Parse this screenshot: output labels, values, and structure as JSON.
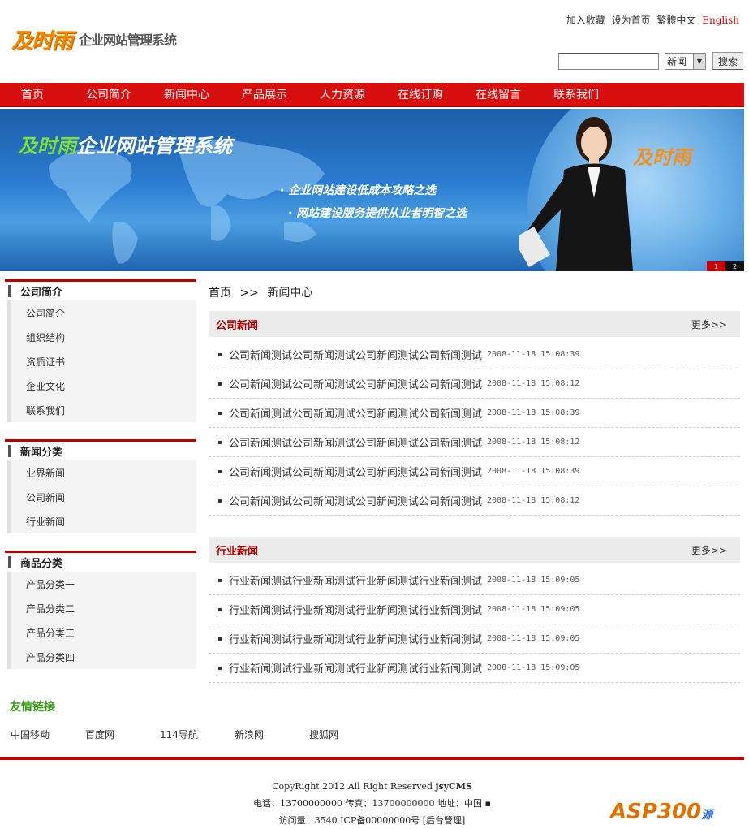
{
  "header": {
    "logo_big": "及时雨",
    "logo_small": "企业网站管理系统",
    "links": [
      "加入收藏",
      "设为首页",
      "繁體中文",
      "English"
    ],
    "search": {
      "placeholder": "",
      "select_value": "新闻",
      "button": "搜索"
    }
  },
  "nav": [
    "首页",
    "公司简介",
    "新闻中心",
    "产品展示",
    "人力资源",
    "在线订购",
    "在线留言",
    "联系我们"
  ],
  "banner": {
    "title_green": "及时雨",
    "title_white": "企业网站管理系统",
    "slogan1": "· 企业网站建设低成本攻略之选",
    "slogan2": "· 网站建设服务提供从业者明智之选",
    "brand": "及时雨",
    "nums": [
      "1",
      "2"
    ]
  },
  "sidebar": [
    {
      "title": "公司简介",
      "items": [
        "公司简介",
        "组织结构",
        "资质证书",
        "企业文化",
        "联系我们"
      ]
    },
    {
      "title": "新闻分类",
      "items": [
        "业界新闻",
        "公司新闻",
        "行业新闻"
      ]
    },
    {
      "title": "商品分类",
      "items": [
        "产品分类一",
        "产品分类二",
        "产品分类三",
        "产品分类四"
      ]
    }
  ],
  "friend_links": {
    "title": "友情链接",
    "items": [
      "中国移动",
      "百度网",
      "114导航",
      "新浪网",
      "搜狐网"
    ]
  },
  "breadcrumb": {
    "home": "首页",
    "sep": ">>",
    "current": "新闻中心"
  },
  "sections": [
    {
      "title": "公司新闻",
      "more": "更多>>",
      "items": [
        {
          "title": "公司新闻测试公司新闻测试公司新闻测试公司新闻测试",
          "date": "2008-11-18 15:08:39"
        },
        {
          "title": "公司新闻测试公司新闻测试公司新闻测试公司新闻测试",
          "date": "2008-11-18 15:08:12"
        },
        {
          "title": "公司新闻测试公司新闻测试公司新闻测试公司新闻测试",
          "date": "2008-11-18 15:08:39"
        },
        {
          "title": "公司新闻测试公司新闻测试公司新闻测试公司新闻测试",
          "date": "2008-11-18 15:08:12"
        },
        {
          "title": "公司新闻测试公司新闻测试公司新闻测试公司新闻测试",
          "date": "2008-11-18 15:08:39"
        },
        {
          "title": "公司新闻测试公司新闻测试公司新闻测试公司新闻测试",
          "date": "2008-11-18 15:08:12"
        }
      ]
    },
    {
      "title": "行业新闻",
      "more": "更多>>",
      "items": [
        {
          "title": "行业新闻测试行业新闻测试行业新闻测试行业新闻测试",
          "date": "2008-11-18 15:09:05"
        },
        {
          "title": "行业新闻测试行业新闻测试行业新闻测试行业新闻测试",
          "date": "2008-11-18 15:09:05"
        },
        {
          "title": "行业新闻测试行业新闻测试行业新闻测试行业新闻测试",
          "date": "2008-11-18 15:09:05"
        },
        {
          "title": "行业新闻测试行业新闻测试行业新闻测试行业新闻测试",
          "date": "2008-11-18 15:09:05"
        }
      ]
    }
  ],
  "footer": {
    "line1_pre": "CopyRight 2012 All Right Reserved ",
    "line1_brand": "jsyCMS",
    "line2": "电话：13700000000 传真：13700000000 地址：中国 ▪",
    "line3": "访问量：3540 ICP备00000000号 [后台管理]"
  },
  "watermark": {
    "main": "ASP300",
    "sub": "源码.com"
  }
}
